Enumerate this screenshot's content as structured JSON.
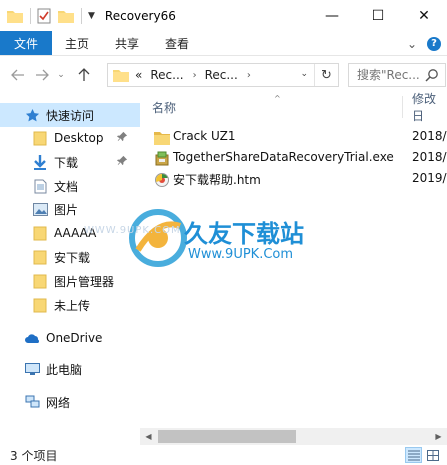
{
  "window": {
    "title": "Recovery66",
    "minimize_glyph": "—",
    "maximize_glyph": "☐",
    "close_glyph": "✕"
  },
  "ribbon": {
    "tabs": [
      {
        "label": "文件"
      },
      {
        "label": "主页"
      },
      {
        "label": "共享"
      },
      {
        "label": "查看"
      }
    ],
    "expand_glyph": "⌄",
    "help_glyph": "?"
  },
  "address_bar": {
    "overflow": "«",
    "crumbs": [
      "Rec...",
      "Rec..."
    ],
    "chevron": "›",
    "dropdown_glyph": "⌄",
    "refresh_glyph": "↻"
  },
  "search": {
    "placeholder": "搜索\"Rec..."
  },
  "nav_pane": {
    "items": [
      {
        "label": "快速访问",
        "icon": "star-icon"
      },
      {
        "label": "Desktop",
        "icon": "folder-icon",
        "pinned": true
      },
      {
        "label": "下载",
        "icon": "download-icon",
        "pinned": true
      },
      {
        "label": "文档",
        "icon": "document-icon"
      },
      {
        "label": "图片",
        "icon": "pictures-icon"
      },
      {
        "label": "AAAAA",
        "icon": "folder-icon"
      },
      {
        "label": "安下载",
        "icon": "folder-icon"
      },
      {
        "label": "图片管理器",
        "icon": "folder-icon"
      },
      {
        "label": "未上传",
        "icon": "folder-icon"
      },
      {
        "label": "OneDrive",
        "icon": "cloud-icon"
      },
      {
        "label": "此电脑",
        "icon": "computer-icon"
      },
      {
        "label": "网络",
        "icon": "network-icon"
      }
    ],
    "pin_glyph": "📌"
  },
  "file_list": {
    "columns": {
      "name": "名称",
      "modified": "修改日"
    },
    "sort_glyph": "^",
    "rows": [
      {
        "name": "Crack UZ1",
        "date": "2018/",
        "icon": "folder-icon"
      },
      {
        "name": "TogetherShareDataRecoveryTrial.exe",
        "date": "2018/",
        "icon": "installer-icon"
      },
      {
        "name": "安下载帮助.htm",
        "date": "2019/",
        "icon": "htm-file-icon"
      }
    ]
  },
  "watermark": {
    "brand": "久友下载站",
    "url": "Www.9UPK.Com",
    "faint": "WWW.9UPK.COM"
  },
  "scrollbar": {
    "left_glyph": "◀",
    "right_glyph": "▶"
  },
  "status_bar": {
    "item_count": "3 个项目"
  },
  "colors": {
    "accent": "#1979ca",
    "selected": "#cce8ff",
    "folder": "#f8d775"
  }
}
